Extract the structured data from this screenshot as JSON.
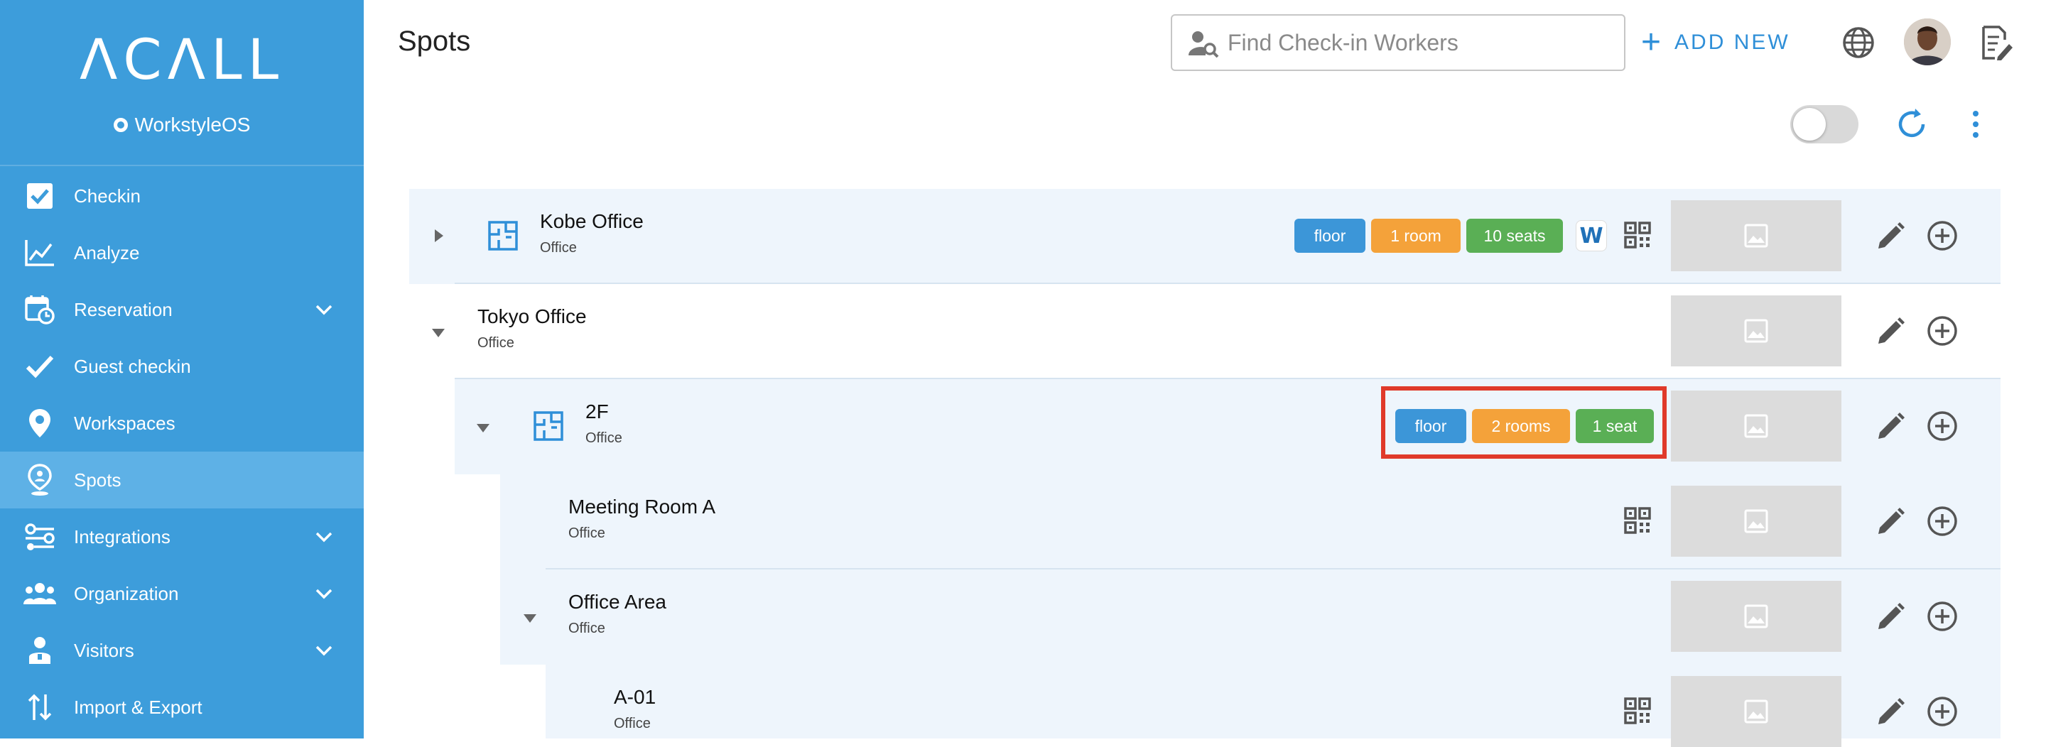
{
  "app": {
    "logo": "ΛCΛLL",
    "product": "WorkstyleOS"
  },
  "sidebar": {
    "items": [
      {
        "label": "Checkin",
        "icon": "checkbox-icon",
        "expandable": false,
        "active": false
      },
      {
        "label": "Analyze",
        "icon": "line-chart-icon",
        "expandable": false,
        "active": false
      },
      {
        "label": "Reservation",
        "icon": "calendar-clock-icon",
        "expandable": true,
        "active": false
      },
      {
        "label": "Guest checkin",
        "icon": "checkmark-icon",
        "expandable": false,
        "active": false
      },
      {
        "label": "Workspaces",
        "icon": "map-pin-icon",
        "expandable": false,
        "active": false
      },
      {
        "label": "Spots",
        "icon": "location-person-icon",
        "expandable": false,
        "active": true
      },
      {
        "label": "Integrations",
        "icon": "integrations-icon",
        "expandable": true,
        "active": false
      },
      {
        "label": "Organization",
        "icon": "people-group-icon",
        "expandable": true,
        "active": false
      },
      {
        "label": "Visitors",
        "icon": "visitor-badge-icon",
        "expandable": true,
        "active": false
      },
      {
        "label": "Import & Export",
        "icon": "import-export-icon",
        "expandable": false,
        "active": false
      }
    ]
  },
  "header": {
    "title": "Spots",
    "search": {
      "placeholder": "Find Check-in Workers",
      "value": ""
    },
    "add_new_label": "ADD NEW"
  },
  "toolbar": {
    "toggle_on": false
  },
  "tree": [
    {
      "title": "Kobe Office",
      "subtitle": "Office",
      "expanded": false,
      "tags": [
        "floor",
        "1 room",
        "10 seats"
      ],
      "has_w_badge": true,
      "has_qr": true
    },
    {
      "title": "Tokyo Office",
      "subtitle": "Office",
      "expanded": true,
      "tags": [],
      "has_w_badge": false,
      "has_qr": false
    },
    {
      "title": "2F",
      "subtitle": "Office",
      "expanded": true,
      "tags": [
        "floor",
        "2 rooms",
        "1 seat"
      ],
      "has_w_badge": false,
      "has_qr": false,
      "highlighted": true
    },
    {
      "title": "Meeting Room A",
      "subtitle": "Office",
      "expanded": null,
      "tags": [],
      "has_w_badge": false,
      "has_qr": true
    },
    {
      "title": "Office Area",
      "subtitle": "Office",
      "expanded": true,
      "tags": [],
      "has_w_badge": false,
      "has_qr": false
    },
    {
      "title": "A-01",
      "subtitle": "Office",
      "expanded": null,
      "tags": [],
      "has_w_badge": false,
      "has_qr": true
    }
  ],
  "colors": {
    "sidebar": "#3d9ddb",
    "sidebar_active": "#5eb1e6",
    "accent": "#2f8fd8",
    "tag_floor": "#3c96d8",
    "tag_room": "#f4a23a",
    "tag_seat": "#5aaf55",
    "highlight": "#e03a2a"
  }
}
